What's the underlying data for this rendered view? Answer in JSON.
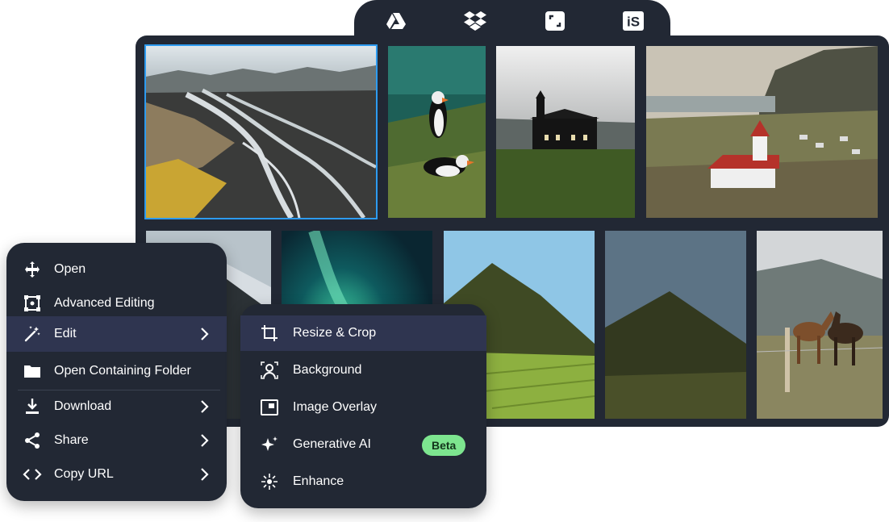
{
  "source_tabs": [
    {
      "name": "google-drive-icon"
    },
    {
      "name": "dropbox-icon"
    },
    {
      "name": "crop-frame-icon"
    },
    {
      "name": "istock-logo-icon",
      "text": "iS"
    }
  ],
  "gallery": {
    "images": [
      {
        "name": "thumb-river-delta",
        "selected": true
      },
      {
        "name": "thumb-puffins"
      },
      {
        "name": "thumb-black-church"
      },
      {
        "name": "thumb-coastal-church"
      },
      {
        "name": "thumb-snowy-mountain"
      },
      {
        "name": "thumb-aurora"
      },
      {
        "name": "thumb-green-mountain"
      },
      {
        "name": "thumb-dark-mountain"
      },
      {
        "name": "thumb-horses"
      }
    ]
  },
  "context_menu": {
    "items": [
      {
        "label": "Open",
        "icon": "move-arrows-icon",
        "has_submenu": false
      },
      {
        "label": "Advanced Editing",
        "icon": "selection-frame-icon",
        "has_submenu": false
      },
      {
        "label": "Edit",
        "icon": "magic-wand-icon",
        "has_submenu": true,
        "active": true
      },
      {
        "label": "Open Containing Folder",
        "icon": "folder-icon",
        "has_submenu": false
      },
      {
        "label": "Download",
        "icon": "download-icon",
        "has_submenu": true
      },
      {
        "label": "Share",
        "icon": "share-icon",
        "has_submenu": true
      },
      {
        "label": "Copy URL",
        "icon": "code-icon",
        "has_submenu": true
      }
    ]
  },
  "edit_submenu": {
    "items": [
      {
        "label": "Resize & Crop",
        "icon": "crop-icon",
        "active": true
      },
      {
        "label": "Background",
        "icon": "background-person-icon"
      },
      {
        "label": "Image Overlay",
        "icon": "overlay-icon"
      },
      {
        "label": "Generative AI",
        "icon": "sparkles-icon",
        "badge": "Beta"
      },
      {
        "label": "Enhance",
        "icon": "enhance-icon"
      }
    ]
  },
  "colors": {
    "panel": "#222834",
    "active_row": "#2f3550",
    "selection": "#2d9bf0",
    "badge_bg": "#7de58f"
  }
}
